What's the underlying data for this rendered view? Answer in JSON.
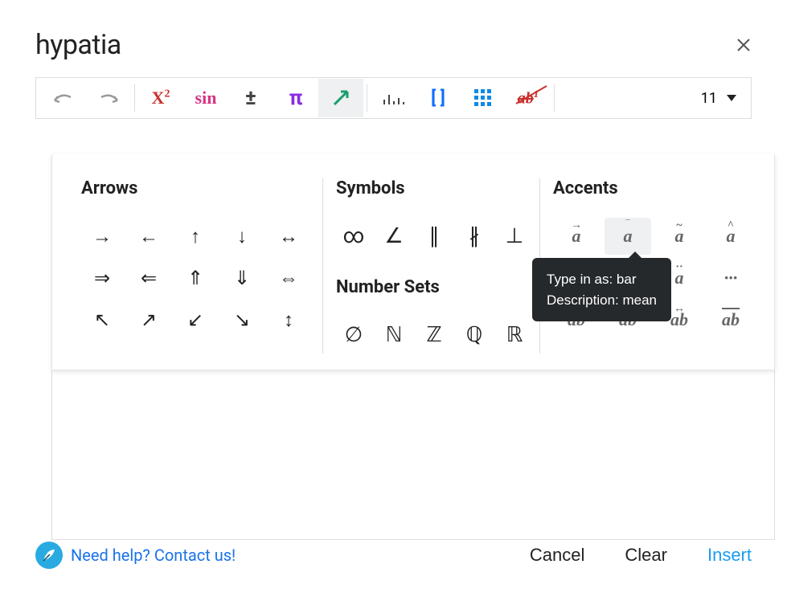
{
  "title": "hypatia",
  "toolbar": {
    "x_squared_base": "X",
    "x_squared_exp": "2",
    "sin": "sin",
    "plus_minus": "±",
    "pi": "π",
    "brackets": "[  ]",
    "strike_base": "ab",
    "strike_exp": "1",
    "font_size": "11"
  },
  "sections": {
    "arrows": "Arrows",
    "symbols": "Symbols",
    "number_sets": "Number Sets",
    "accents": "Accents"
  },
  "arrows": [
    "→",
    "←",
    "↑",
    "↓",
    "↔",
    "⇒",
    "⇐",
    "⇑",
    "⇓",
    "⇔",
    "↖",
    "↗",
    "↙",
    "↘",
    "↕"
  ],
  "symbols": [
    "∞",
    "∠",
    "∥",
    "∦",
    "⊥"
  ],
  "number_sets": [
    "∅",
    "ℕ",
    "ℤ",
    "ℚ",
    "ℝ"
  ],
  "accents": {
    "items": [
      {
        "base": "a",
        "mark": "→"
      },
      {
        "base": "a",
        "mark": "‾"
      },
      {
        "base": "a",
        "mark": "~"
      },
      {
        "base": "a",
        "mark": "^"
      },
      {
        "base": "",
        "mark": ""
      },
      {
        "base": "",
        "mark": ""
      },
      {
        "base": "a",
        "mark": "··"
      },
      {
        "base": "···",
        "mark": ""
      },
      {
        "base": "ab",
        "mark": "←"
      },
      {
        "base": "ab",
        "mark": "→"
      },
      {
        "base": "ab",
        "mark": "↔"
      },
      {
        "base": "ab",
        "mark": "‾"
      }
    ]
  },
  "tooltip": {
    "line1": "Type in as: bar",
    "line2": "Description: mean"
  },
  "footer": {
    "help": "Need help? Contact us!",
    "cancel": "Cancel",
    "clear": "Clear",
    "insert": "Insert"
  }
}
